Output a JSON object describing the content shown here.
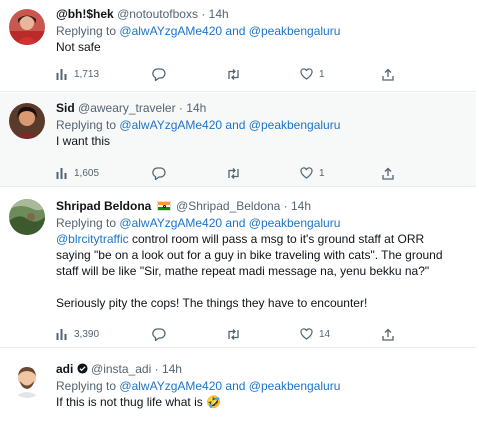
{
  "tweets": [
    {
      "name": "@bh!$hek",
      "handle": "@notoutofboxs",
      "separator": "·",
      "time": "14h",
      "replying_prefix": "Replying to",
      "reply_user_1": "@alwAYzgAMe420",
      "reply_and": "and",
      "reply_user_2": "@peakbengaluru",
      "text": "Not safe",
      "views": "1,713",
      "likes": "1"
    },
    {
      "name": "Sid",
      "handle": "@aweary_traveler",
      "separator": "·",
      "time": "14h",
      "replying_prefix": "Replying to",
      "reply_user_1": "@alwAYzgAMe420",
      "reply_and": "and",
      "reply_user_2": "@peakbengaluru",
      "text": "I want this",
      "views": "1,605",
      "likes": "1"
    },
    {
      "name": "Shripad Beldona",
      "handle": "@Shripad_Beldona",
      "separator": "·",
      "time": "14h",
      "replying_prefix": "Replying to",
      "reply_user_1": "@alwAYzgAMe420",
      "reply_and": "and",
      "reply_user_2": "@peakbengaluru",
      "mention": "@blrcitytraffic",
      "text_line_1": " control room will pass a msg to it's ground staff at ORR",
      "text_line_2": "saying \"be on a look out for a guy in bike traveling with cats\". The ground",
      "text_line_3": "staff will be like \"Sir, mathe repeat madi message na, yenu bekku na?\"",
      "text_line_4": "Seriously pity the cops! The things they have to encounter!",
      "views": "3,390",
      "likes": "14"
    },
    {
      "name": "adi",
      "handle": "@insta_adi",
      "separator": "·",
      "time": "14h",
      "replying_prefix": "Replying to",
      "reply_user_1": "@alwAYzgAMe420",
      "reply_and": "and",
      "reply_user_2": "@peakbengaluru",
      "text": "If this is not thug life what is",
      "emoji": "🤣"
    }
  ],
  "icons": {
    "views": "bar-chart-icon",
    "reply": "comment-icon",
    "retweet": "retweet-icon",
    "like": "heart-icon",
    "share": "share-icon"
  },
  "colors": {
    "link": "#1d74c9",
    "muted": "#536471",
    "text": "#0f1419"
  }
}
